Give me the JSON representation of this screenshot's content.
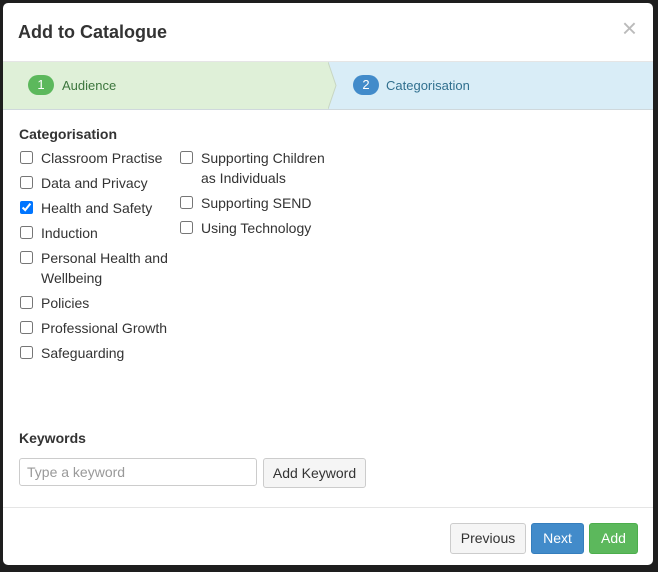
{
  "modal": {
    "title": "Add to Catalogue",
    "close_symbol": "×"
  },
  "wizard": {
    "steps": [
      {
        "number": "1",
        "label": "Audience",
        "state": "completed"
      },
      {
        "number": "2",
        "label": "Categorisation",
        "state": "active"
      }
    ],
    "colors": {
      "completed_bg": "#dff0d8",
      "completed_badge": "#5cb85c",
      "completed_text": "#3c763d",
      "active_bg": "#d9edf7",
      "active_badge": "#428bca",
      "active_text": "#31708f"
    }
  },
  "categorisation": {
    "label": "Categorisation",
    "options": [
      {
        "label": "Classroom Practise",
        "checked": false
      },
      {
        "label": "Data and Privacy",
        "checked": false
      },
      {
        "label": "Health and Safety",
        "checked": true
      },
      {
        "label": "Induction",
        "checked": false
      },
      {
        "label": "Personal Health and Wellbeing",
        "checked": false
      },
      {
        "label": "Policies",
        "checked": false
      },
      {
        "label": "Professional Growth",
        "checked": false
      },
      {
        "label": "Safeguarding",
        "checked": false
      },
      {
        "label": "Supporting Children as Individuals",
        "checked": false
      },
      {
        "label": "Supporting SEND",
        "checked": false
      },
      {
        "label": "Using Technology",
        "checked": false
      }
    ]
  },
  "keywords": {
    "label": "Keywords",
    "input_value": "",
    "placeholder": "Type a keyword",
    "add_button": "Add Keyword"
  },
  "footer": {
    "previous": "Previous",
    "next": "Next",
    "add": "Add"
  }
}
